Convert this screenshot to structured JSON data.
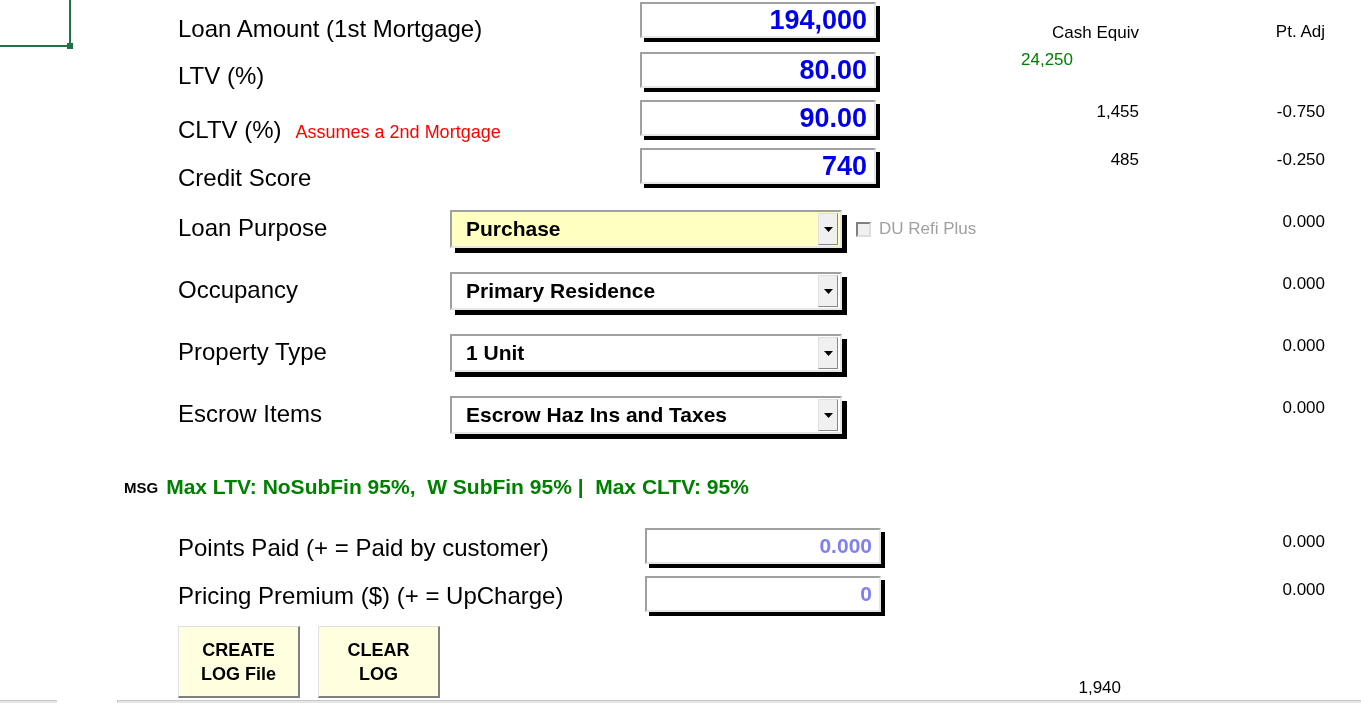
{
  "headers": {
    "cash": "Cash Equiv",
    "adj": "Pt. Adj",
    "cash_summary": "24,250"
  },
  "fields": [
    {
      "kind": "input",
      "label": "Loan Amount (1st Mortgage)",
      "value": "194,000",
      "dimmed": false
    },
    {
      "kind": "input",
      "label": "LTV (%)",
      "value": "80.00",
      "dimmed": false
    },
    {
      "kind": "input",
      "label": "CLTV (%)",
      "note": "Assumes a 2nd Mortgage",
      "value": "90.00",
      "dimmed": false,
      "cash": "1,455",
      "adj": "-0.750"
    },
    {
      "kind": "input",
      "label": "Credit Score",
      "value": "740",
      "dimmed": false,
      "cash": "485",
      "adj": "-0.250"
    },
    {
      "kind": "select",
      "label": "Loan Purpose",
      "value": "Purchase",
      "highlighted": true,
      "checkbox": {
        "label": "DU Refi Plus",
        "checked": false,
        "disabled": true
      },
      "adj": "0.000"
    },
    {
      "kind": "select",
      "label": "Occupancy",
      "value": "Primary Residence",
      "highlighted": false,
      "adj": "0.000"
    },
    {
      "kind": "select",
      "label": "Property Type",
      "value": "1 Unit",
      "highlighted": false,
      "adj": "0.000"
    },
    {
      "kind": "select",
      "label": "Escrow Items",
      "value": "Escrow Haz Ins and Taxes",
      "highlighted": false,
      "adj": "0.000"
    }
  ],
  "message": {
    "label": "MSG",
    "text": "Max LTV: NoSubFin 95%,  W SubFin 95% |  Max CLTV: 95%"
  },
  "pricing": [
    {
      "label": "Points Paid (+ = Paid by customer)",
      "value": "0.000",
      "dimmed": true,
      "adj": "0.000"
    },
    {
      "label": "Pricing Premium ($) (+ = UpCharge)",
      "value": "0",
      "dimmed": true,
      "adj": "0.000"
    }
  ],
  "buttons": [
    {
      "lines": [
        "CREATE",
        "LOG File"
      ]
    },
    {
      "lines": [
        "CLEAR",
        "LOG"
      ]
    }
  ],
  "footer": {
    "cash": "1,940"
  }
}
